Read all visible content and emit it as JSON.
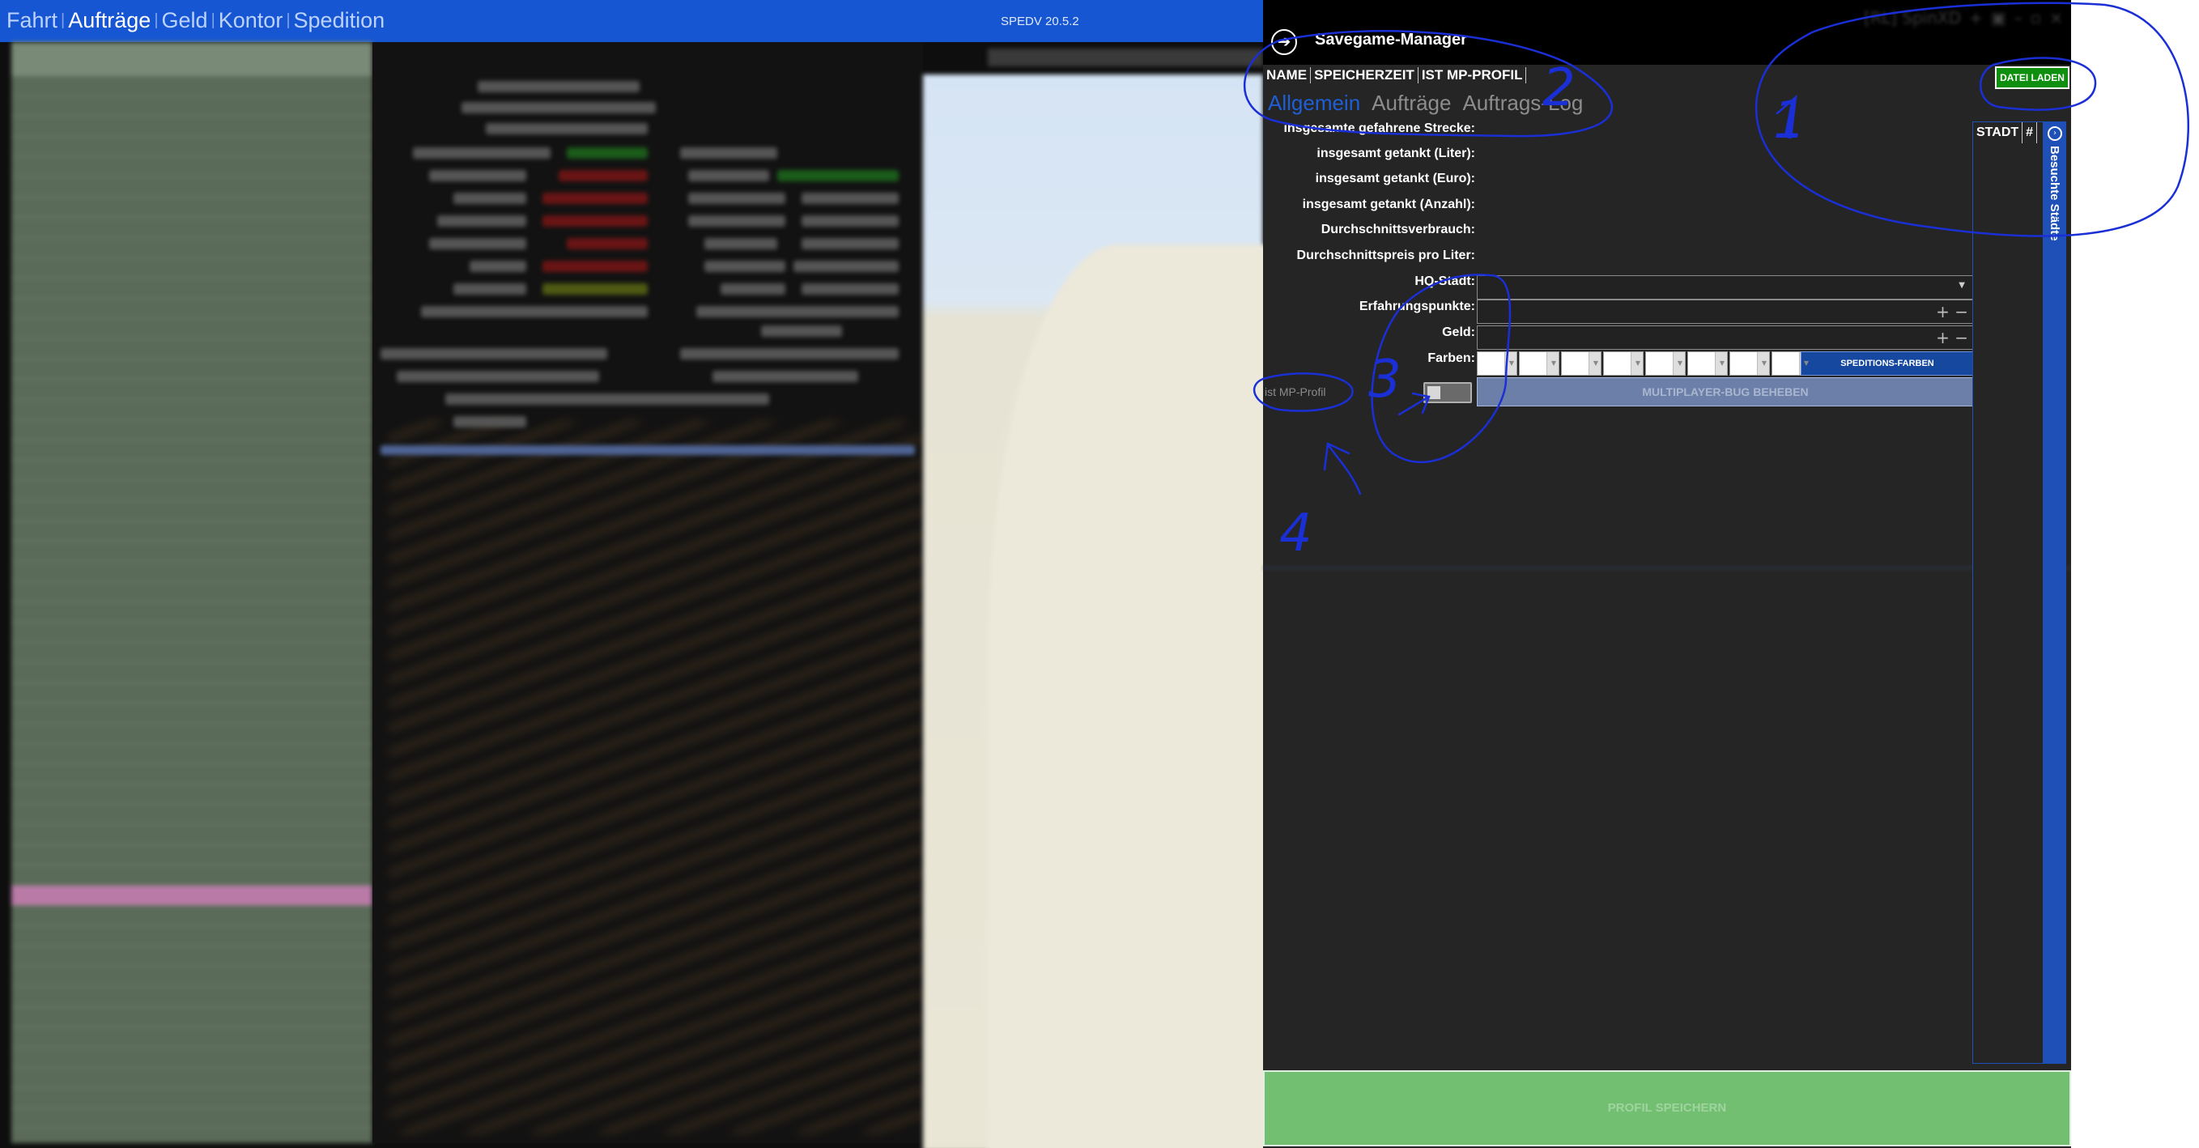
{
  "titlebar": {
    "nav_items": [
      "Fahrt",
      "Aufträge",
      "Geld",
      "Kontor",
      "Spedition"
    ],
    "active_item": "Aufträge",
    "version": "SPEDV 20.5.2"
  },
  "savegame_manager": {
    "title": "Savegame-Manager",
    "user": "[RL] SpinXD",
    "load_button": "DATEI LADEN",
    "columns": [
      "NAME",
      "SPEICHERZEIT",
      "IST MP-PROFIL"
    ],
    "tabs": [
      "Allgemein",
      "Aufträge",
      "Auftrags-Log"
    ],
    "active_tab": "Allgemein",
    "fields": {
      "strecke": "insgesamte gefahrene Strecke:",
      "liter": "insgesamt getankt (Liter):",
      "euro": "insgesamt getankt (Euro):",
      "anzahl": "insgesamt getankt (Anzahl):",
      "verbrauch": "Durchschnittsverbrauch:",
      "preis": "Durchschnittspreis pro Liter:",
      "hq": "HQ-Stadt:",
      "erfahrung": "Erfahrungspunkte:",
      "geld": "Geld:",
      "farben": "Farben:"
    },
    "speditions_farben_button": "SPEDITIONS-FARBEN",
    "mp_profil_label": "ist MP-Profil",
    "mp_toggle_on": false,
    "mp_bug_button": "MULTIPLAYER-BUG BEHEBEN",
    "stadt_columns": [
      "STADT",
      "#"
    ],
    "side_tab": "Besuchte Städte",
    "save_button": "PROFIL SPEICHERN"
  },
  "annotations": [
    "1",
    "2",
    "3",
    "4"
  ],
  "colors": {
    "accent": "#1656d2",
    "load_button": "#0e8f0e",
    "save_button": "#72bf72",
    "annotation_ink": "#1a2fd6"
  }
}
